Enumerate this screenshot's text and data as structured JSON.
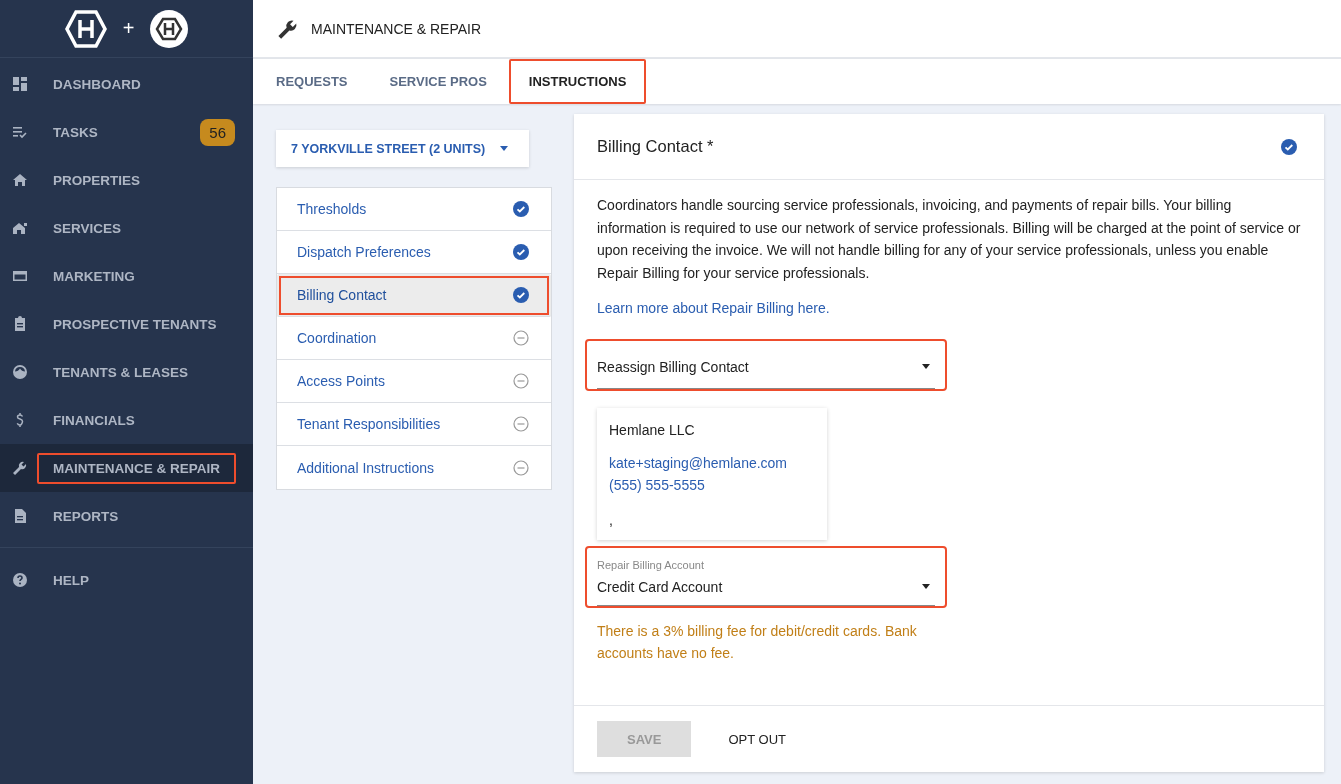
{
  "sidebar": {
    "plus": "+",
    "items": [
      {
        "label": "DASHBOARD",
        "selected": false,
        "highlighted": false
      },
      {
        "label": "TASKS",
        "selected": false,
        "highlighted": false,
        "badge": "56"
      },
      {
        "label": "PROPERTIES",
        "selected": false,
        "highlighted": false
      },
      {
        "label": "SERVICES",
        "selected": false,
        "highlighted": false
      },
      {
        "label": "MARKETING",
        "selected": false,
        "highlighted": false
      },
      {
        "label": "PROSPECTIVE TENANTS",
        "selected": false,
        "highlighted": false
      },
      {
        "label": "TENANTS & LEASES",
        "selected": false,
        "highlighted": false
      },
      {
        "label": "FINANCIALS",
        "selected": false,
        "highlighted": false
      },
      {
        "label": "MAINTENANCE & REPAIR",
        "selected": true,
        "highlighted": true
      },
      {
        "label": "REPORTS",
        "selected": false,
        "highlighted": false
      }
    ],
    "footer_items": [
      {
        "label": "HELP",
        "selected": false
      }
    ]
  },
  "header": {
    "title": "MAINTENANCE & REPAIR"
  },
  "tabs": [
    {
      "label": "REQUESTS",
      "selected": false,
      "highlighted": false
    },
    {
      "label": "SERVICE PROS",
      "selected": false,
      "highlighted": false
    },
    {
      "label": "INSTRUCTIONS",
      "selected": true,
      "highlighted": true
    }
  ],
  "property_selector": {
    "value": "7 YORKVILLE STREET (2 UNITS)"
  },
  "steps": [
    {
      "label": "Thresholds",
      "done": true,
      "selected": false,
      "highlighted": false
    },
    {
      "label": "Dispatch Preferences",
      "done": true,
      "selected": false,
      "highlighted": false
    },
    {
      "label": "Billing Contact",
      "done": true,
      "selected": true,
      "highlighted": true
    },
    {
      "label": "Coordination",
      "done": false,
      "selected": false,
      "highlighted": false
    },
    {
      "label": "Access Points",
      "done": false,
      "selected": false,
      "highlighted": false
    },
    {
      "label": "Tenant Responsibilities",
      "done": false,
      "selected": false,
      "highlighted": false
    },
    {
      "label": "Additional Instructions",
      "done": false,
      "selected": false,
      "highlighted": false
    }
  ],
  "panel": {
    "title": "Billing Contact *",
    "done": true,
    "description": "Coordinators handle sourcing service professionals, invoicing, and payments of repair bills. Your billing information is required to use our network of service professionals. Billing will be charged at the point of service or upon receiving the invoice. We will not handle billing for any of your service professionals, unless you enable Repair Billing for your service professionals.",
    "link": "Learn more about Repair Billing here.",
    "reassign_field": {
      "value": "Reassign Billing Contact",
      "highlighted": true
    },
    "contact": {
      "name": "Hemlane LLC",
      "email": "kate+staging@hemlane.com",
      "phone": "(555) 555-5555",
      "address": ","
    },
    "account_field": {
      "label": "Repair Billing Account",
      "value": "Credit Card Account",
      "highlighted": true
    },
    "fee_note": "There is a 3% billing fee for debit/credit cards. Bank accounts have no fee.",
    "buttons": [
      {
        "label": "SAVE",
        "kind": "primary",
        "disabled": true
      },
      {
        "label": "OPT OUT",
        "kind": "text",
        "disabled": false
      }
    ]
  }
}
